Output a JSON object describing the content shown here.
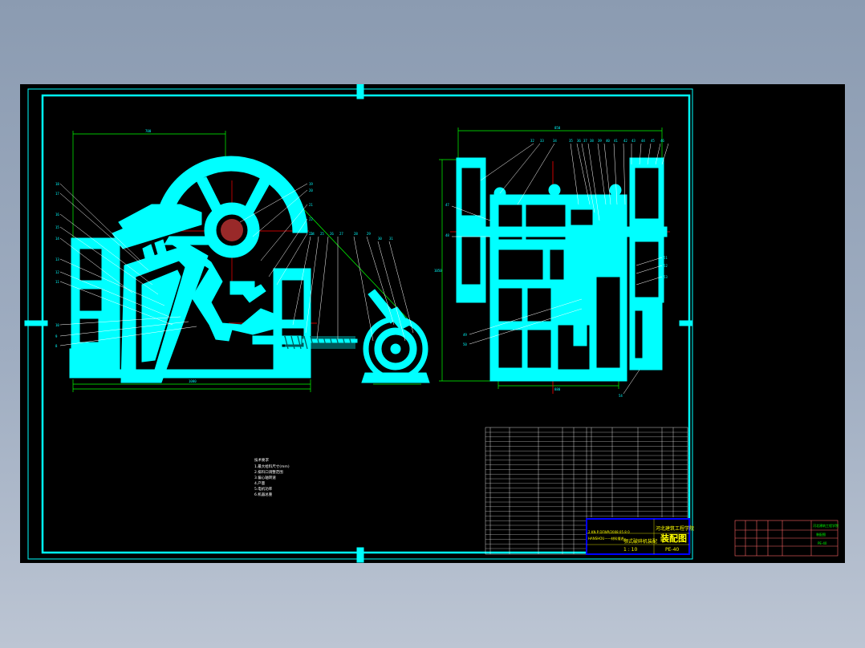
{
  "drawing": {
    "background": "#000000",
    "frame_color": "#00ffff",
    "part_color": "#00ffff",
    "dim_color": "#00ff00",
    "center_color": "#ff0000",
    "leader_color": "#ffffff",
    "title_color": "#ffff00"
  },
  "title_block": {
    "school": "河北建筑工程学院",
    "drawing_type": "装配图",
    "drawing_no": "PE-40",
    "subtitle": "颚式破碎机装配",
    "code_line": "2 KN P  DFWP/2008 05 8 0",
    "note_line": "HANSHOU——材料描述",
    "scale_text": "1 : 10"
  },
  "tech_requirements": {
    "heading": "技术要求",
    "lines": [
      "1.最大给料尺寸(mm)",
      "2.排料口调整范围",
      "3.偏心轴转速",
      "4.产量",
      "5.电机功率",
      "6.机器总重"
    ]
  },
  "side_block": {
    "label_top": "河北建筑工程学院",
    "label_mid": "装配图",
    "label_bottom": "PE-40"
  }
}
